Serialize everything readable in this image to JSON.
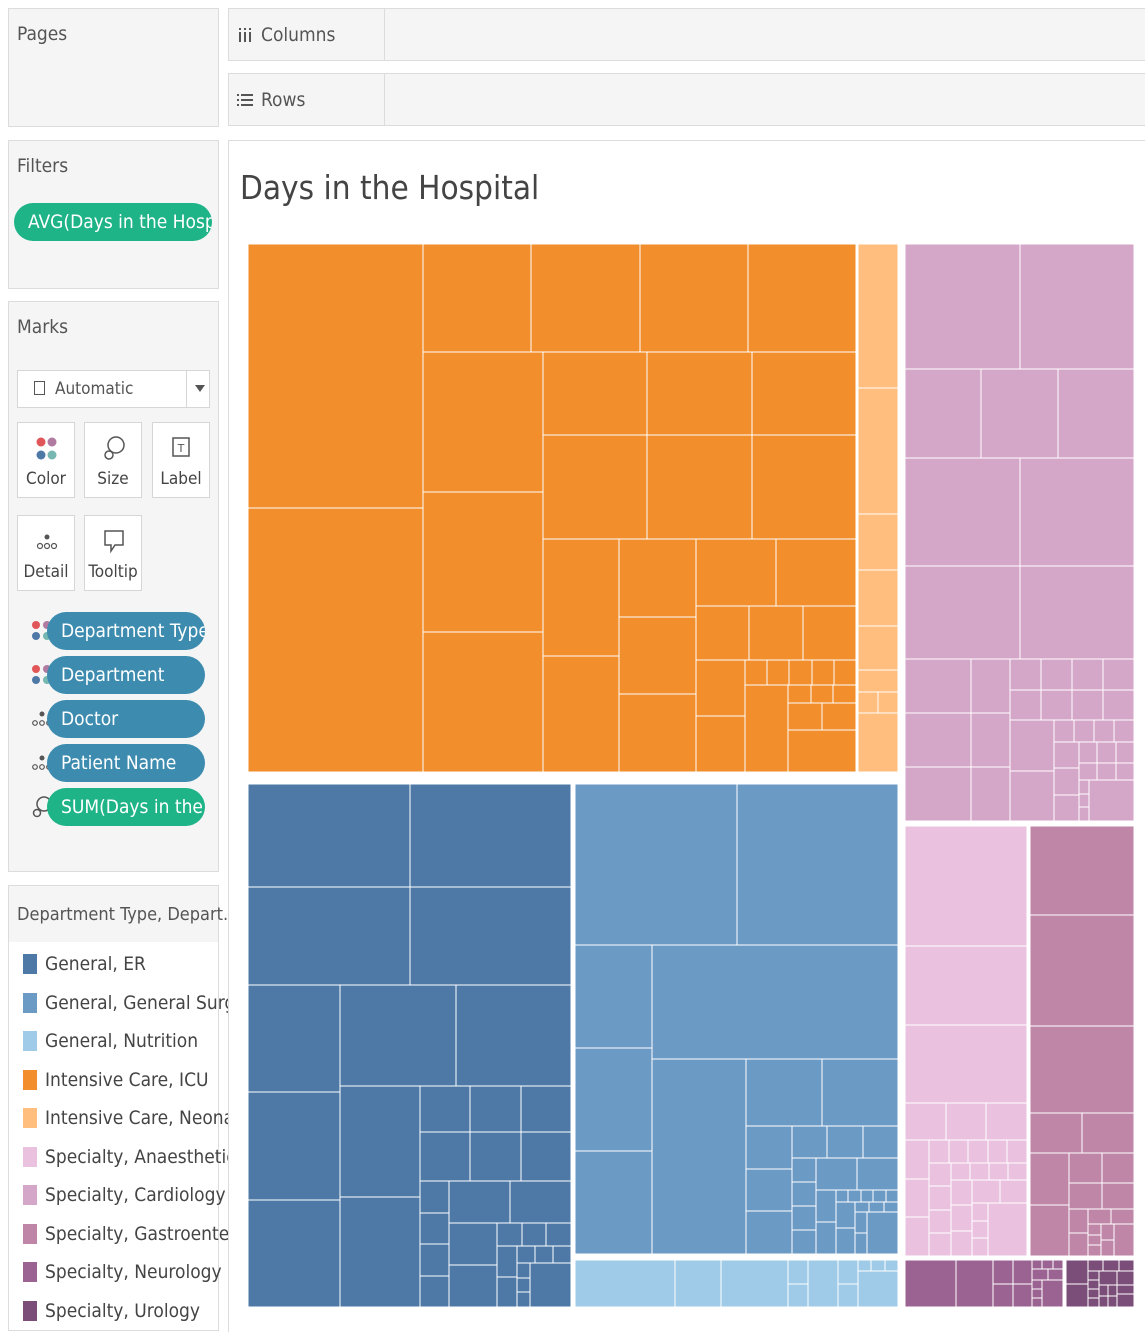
{
  "shelves": {
    "pages": "Pages",
    "columns": "Columns",
    "rows": "Rows",
    "filters": "Filters"
  },
  "filter_pill": "AVG(Days in the Hospi..",
  "marks": {
    "title": "Marks",
    "mark_type": "Automatic",
    "buttons": {
      "color": "Color",
      "size": "Size",
      "label": "Label",
      "detail": "Detail",
      "tooltip": "Tooltip"
    },
    "pills": [
      {
        "label": "Department Type",
        "icon": "color-icon"
      },
      {
        "label": "Department",
        "icon": "color-icon"
      },
      {
        "label": "Doctor",
        "icon": "detail-icon"
      },
      {
        "label": "Patient Name",
        "icon": "detail-icon"
      },
      {
        "label": "SUM(Days in the ..",
        "icon": "size-icon"
      }
    ]
  },
  "legend": {
    "title": "Department Type, Depart...",
    "items": [
      {
        "label": "General, ER",
        "color": "#4e79a7"
      },
      {
        "label": "General, General Surge..",
        "color": "#6b9ac4"
      },
      {
        "label": "General, Nutrition",
        "color": "#a0cbe8"
      },
      {
        "label": "Intensive Care, ICU",
        "color": "#f28e2b"
      },
      {
        "label": "Intensive Care, Neonatal",
        "color": "#ffbe7d"
      },
      {
        "label": "Specialty, Anaesthetics",
        "color": "#eac2df"
      },
      {
        "label": "Specialty, Cardiology",
        "color": "#d4a6c8"
      },
      {
        "label": "Specialty, Gastroenter..",
        "color": "#bf86a8"
      },
      {
        "label": "Specialty, Neurology",
        "color": "#9b6391"
      },
      {
        "label": "Specialty, Urology",
        "color": "#7b4e7a"
      }
    ]
  },
  "chart_data": {
    "type": "treemap",
    "title": "Days in the Hospital",
    "groups": [
      {
        "name": "Intensive Care, ICU",
        "color": "#f28e2b",
        "approx_share": 0.27
      },
      {
        "name": "Intensive Care, Neonatal",
        "color": "#ffbe7d",
        "approx_share": 0.02
      },
      {
        "name": "General, ER",
        "color": "#4e79a7",
        "approx_share": 0.2
      },
      {
        "name": "General, General Surge..",
        "color": "#6b9ac4",
        "approx_share": 0.19
      },
      {
        "name": "General, Nutrition",
        "color": "#a0cbe8",
        "approx_share": 0.03
      },
      {
        "name": "Specialty, Cardiology",
        "color": "#d4a6c8",
        "approx_share": 0.12
      },
      {
        "name": "Specialty, Anaesthetics",
        "color": "#eac2df",
        "approx_share": 0.07
      },
      {
        "name": "Specialty, Gastroenter..",
        "color": "#bf86a8",
        "approx_share": 0.07
      },
      {
        "name": "Specialty, Neurology",
        "color": "#9b6391",
        "approx_share": 0.02
      },
      {
        "name": "Specialty, Urology",
        "color": "#7b4e7a",
        "approx_share": 0.01
      }
    ]
  }
}
